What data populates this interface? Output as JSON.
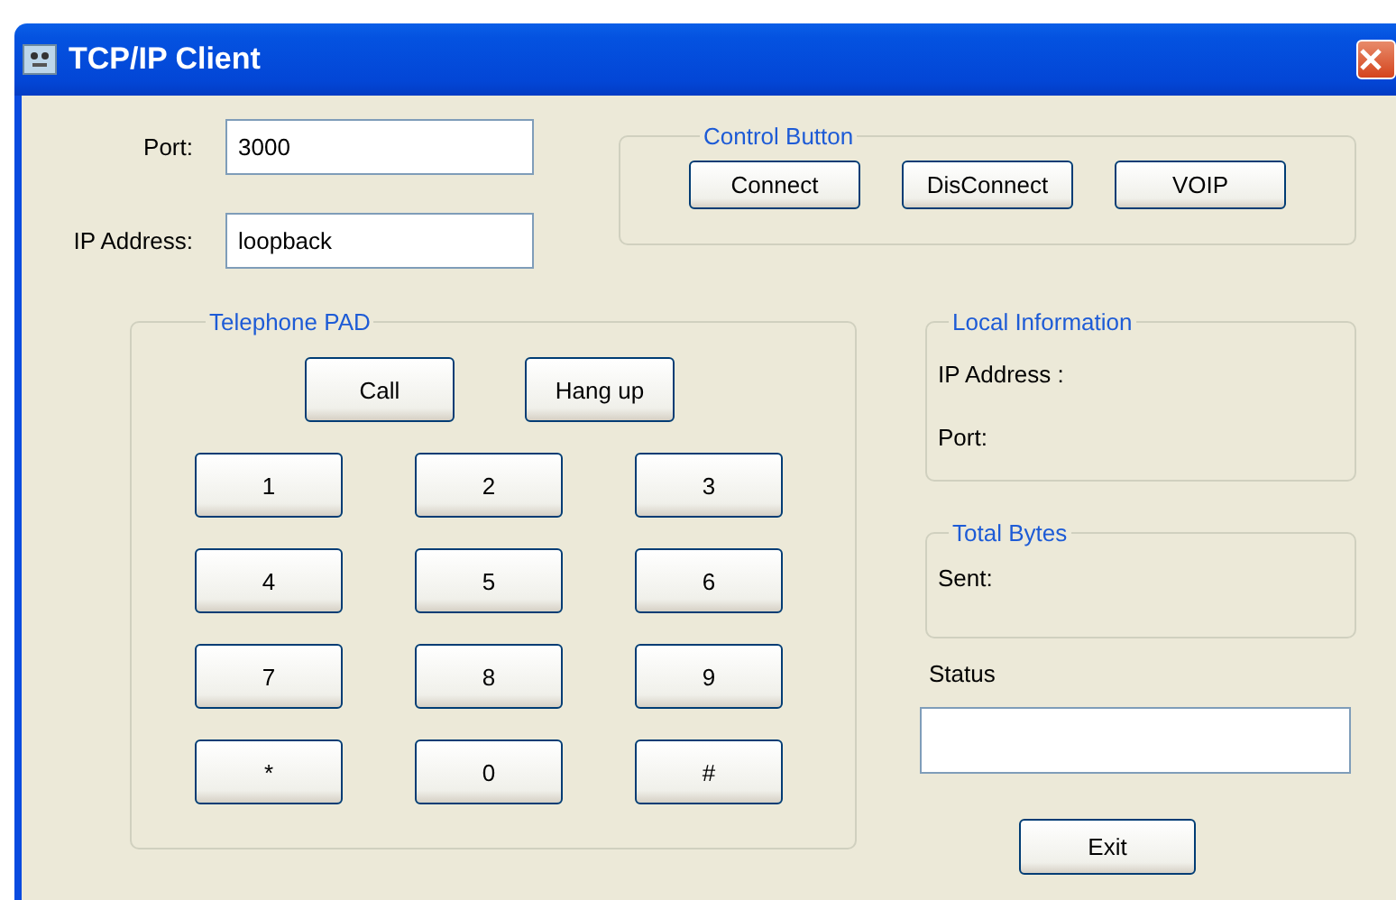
{
  "window": {
    "title": "TCP/IP Client"
  },
  "connection": {
    "fields": [
      {
        "label": "Port:",
        "value": "3000"
      },
      {
        "label": "IP Address:",
        "value": "loopback"
      }
    ]
  },
  "control_button": {
    "title": "Control Button",
    "buttons": [
      "Connect",
      "DisConnect",
      "VOIP"
    ]
  },
  "telephone_pad": {
    "title": "Telephone PAD",
    "call_buttons": [
      "Call",
      "Hang up"
    ],
    "keys": [
      "1",
      "2",
      "3",
      "4",
      "5",
      "6",
      "7",
      "8",
      "9",
      "*",
      "0",
      "#"
    ]
  },
  "local_information": {
    "title": "Local Information",
    "labels": [
      "IP Address :",
      "Port:"
    ]
  },
  "total_bytes": {
    "title": "Total Bytes",
    "labels": [
      "Sent:"
    ]
  },
  "status": {
    "label": "Status"
  },
  "buttons": [
    "Exit"
  ]
}
